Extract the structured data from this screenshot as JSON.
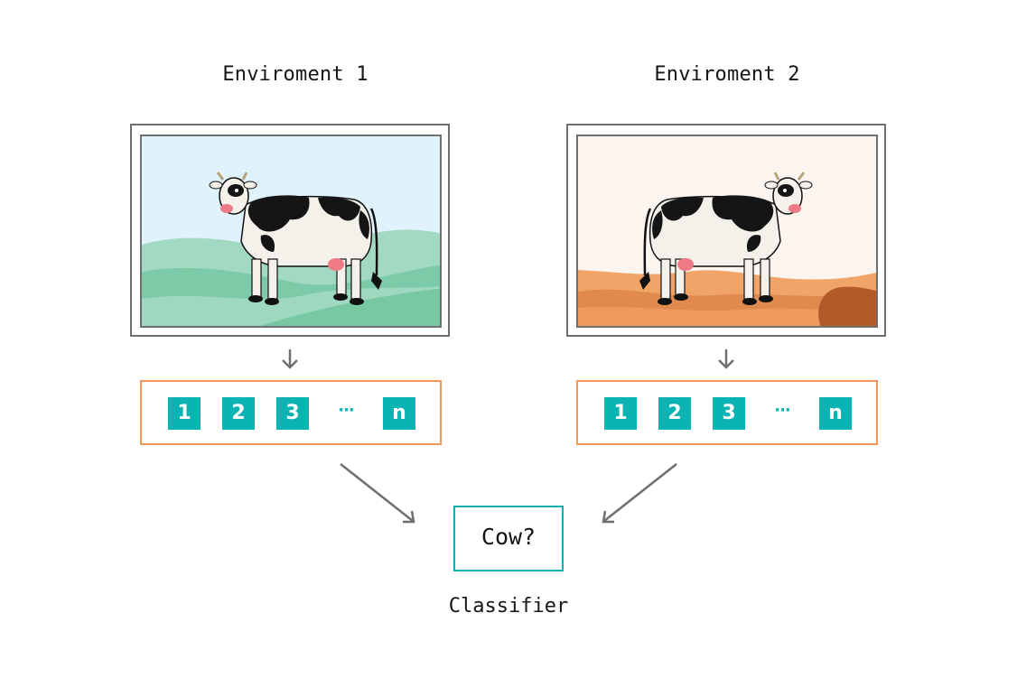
{
  "environments": [
    {
      "title": "Enviroment 1",
      "scene": "grassland",
      "colors": {
        "sky": "#e0f2fb",
        "hill_back": "#a2d9c3",
        "hill_front": "#7dcaa8",
        "grass": "#78c8a4"
      },
      "features": [
        "1",
        "2",
        "3",
        "···",
        "n"
      ]
    },
    {
      "title": "Enviroment 2",
      "scene": "desert",
      "colors": {
        "sky": "#fcf4ef",
        "dune_back": "#f0a467",
        "dune_mid": "#e08a4e",
        "dune_dark": "#b35a2b"
      },
      "features": [
        "1",
        "2",
        "3",
        "···",
        "n"
      ]
    }
  ],
  "classifier": {
    "question": "Cow?",
    "label": "Classifier"
  },
  "icons": {
    "down_arrow": "arrow-down-icon",
    "diagonal_arrow": "arrow-diagonal-icon",
    "subject": "cow-icon"
  },
  "colors": {
    "frame": "#6f6f6f",
    "feature_border": "#f4965a",
    "feature_fill": "#0bb3b3",
    "classifier_border": "#12b1b1",
    "arrow": "#6f6f6f"
  }
}
